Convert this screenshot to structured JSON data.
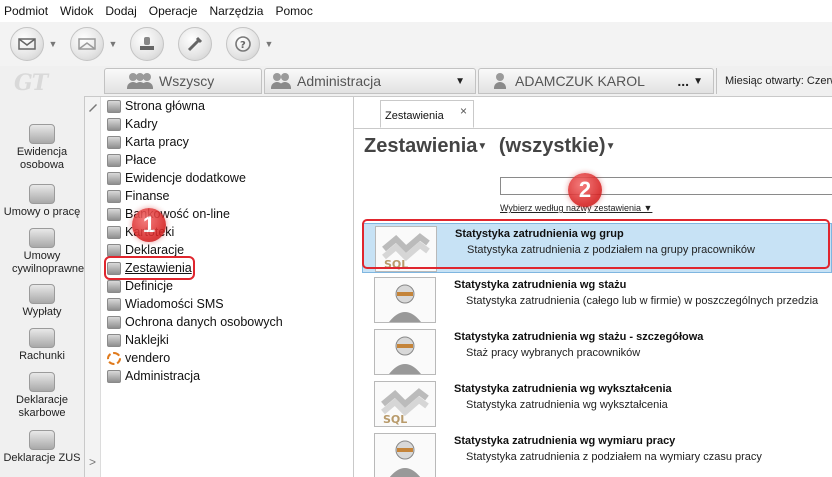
{
  "menu": [
    "Podmiot",
    "Widok",
    "Dodaj",
    "Operacje",
    "Narzędzia",
    "Pomoc"
  ],
  "toolbar": {
    "buttons": [
      {
        "icon": "mail-send-icon",
        "has_dropdown": true
      },
      {
        "icon": "mail-receive-icon",
        "has_dropdown": true
      },
      {
        "icon": "stamp-icon",
        "has_dropdown": false
      },
      {
        "icon": "tools-icon",
        "has_dropdown": false
      },
      {
        "icon": "help-icon",
        "has_dropdown": true
      }
    ]
  },
  "brand": {
    "logo_text": "GT"
  },
  "tabs": {
    "wszyscy": "Wszyscy",
    "administracja": "Administracja",
    "employee": "ADAMCZUK KAROL",
    "employee_more": "...",
    "miesiac": "Miesiąc otwarty: Czerw"
  },
  "rail": [
    {
      "label": "Ewidencja osobowa"
    },
    {
      "label": "Umowy o pracę"
    },
    {
      "label": "Umowy cywilnoprawne"
    },
    {
      "label": "Wypłaty"
    },
    {
      "label": "Rachunki"
    },
    {
      "label": "Deklaracje skarbowe"
    },
    {
      "label": "Deklaracje ZUS"
    }
  ],
  "tree": {
    "expand_arrow": ">",
    "items": [
      {
        "label": "Strona główna"
      },
      {
        "label": "Kadry"
      },
      {
        "label": "Karta pracy"
      },
      {
        "label": "Płace"
      },
      {
        "label": "Ewidencje dodatkowe"
      },
      {
        "label": "Finanse"
      },
      {
        "label": "Bankowość on-line"
      },
      {
        "label": "Kartoteki"
      },
      {
        "label": "Deklaracje"
      },
      {
        "label": "Zestawienia",
        "selected": true
      },
      {
        "label": "Definicje"
      },
      {
        "label": "Wiadomości SMS"
      },
      {
        "label": "Ochrona danych osobowych"
      },
      {
        "label": "Naklejki"
      },
      {
        "label": "vendero"
      },
      {
        "label": "Administracja"
      }
    ]
  },
  "badges": {
    "one": "1",
    "two": "2"
  },
  "content": {
    "tab_label": "Zestawienia",
    "tab_close": "×",
    "title": "Zestawienia",
    "filter_value": "(wszystkie)",
    "search_value": "",
    "filter_link": "Wybierz według nazwy zestawienia",
    "reports": [
      {
        "title": "Statystyka zatrudnienia wg grup",
        "subtitle": "Statystyka zatrudnienia z podziałem na grupy pracowników",
        "thumb": "sql",
        "active": true
      },
      {
        "title": "Statystyka zatrudnienia wg stażu",
        "subtitle": "Statystyka zatrudnienia (całego lub w firmie) w poszczególnych przedzia",
        "thumb": "person",
        "active": false
      },
      {
        "title": "Statystyka zatrudnienia wg stażu - szczegółowa",
        "subtitle": "Staż pracy wybranych pracowników",
        "thumb": "person",
        "active": false
      },
      {
        "title": "Statystyka zatrudnienia wg wykształcenia",
        "subtitle": "Statystyka zatrudnienia wg wykształcenia",
        "thumb": "sql",
        "active": false
      },
      {
        "title": "Statystyka zatrudnienia wg wymiaru pracy",
        "subtitle": "Statystyka zatrudnienia z podziałem na wymiary czasu pracy",
        "thumb": "person",
        "active": false
      }
    ]
  }
}
